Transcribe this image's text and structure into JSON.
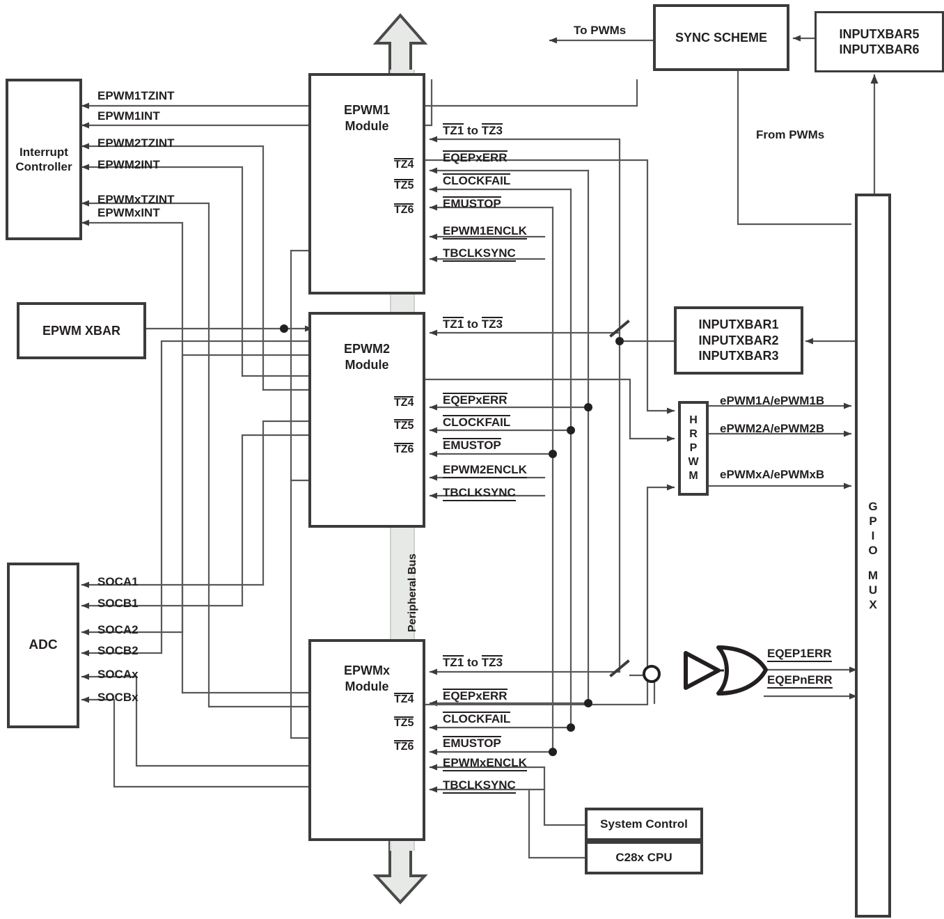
{
  "diagram": {
    "title": "ePWM Module Block Diagram",
    "colors": {
      "ink": "#231f20",
      "box_border": "#3b3b3b",
      "wire": "#58585a",
      "bus_fill": "#e7e9e7",
      "bus_border": "#4a4a4a",
      "page": "#ffffff"
    }
  },
  "blocks": {
    "interrupt_controller": {
      "line1": "Interrupt",
      "line2": "Controller"
    },
    "epwm_xbar": {
      "label": "EPWM XBAR"
    },
    "adc": {
      "label": "ADC"
    },
    "epwm1": {
      "line1": "EPWM1",
      "line2": "Module"
    },
    "epwm2": {
      "line1": "EPWM2",
      "line2": "Module"
    },
    "epwmx": {
      "line1": "EPWMx",
      "line2": "Module"
    },
    "sync_scheme": {
      "label": "SYNC SCHEME"
    },
    "inputxbar56": {
      "line1": "INPUTXBAR5",
      "line2": "INPUTXBAR6"
    },
    "inputxbar123": {
      "line1": "INPUTXBAR1",
      "line2": "INPUTXBAR2",
      "line3": "INPUTXBAR3"
    },
    "hrpwm": {
      "letters": [
        "H",
        "R",
        "P",
        "W",
        "M"
      ]
    },
    "gpio_mux": {
      "letters": [
        "G",
        "P",
        "I",
        "O",
        "",
        "M",
        "U",
        "X"
      ]
    },
    "system_control": {
      "label": "System Control"
    },
    "c28x_cpu": {
      "label": "C28x CPU"
    },
    "peripheral_bus": {
      "label": "Peripheral Bus"
    }
  },
  "interrupt_signals": [
    {
      "name": "EPWM1TZINT"
    },
    {
      "name": "EPWM1INT"
    },
    {
      "name": "EPWM2TZINT"
    },
    {
      "name": "EPWM2INT"
    },
    {
      "name": "EPWMxTZINT"
    },
    {
      "name": "EPWMxINT"
    }
  ],
  "adc_signals": [
    {
      "name": "SOCA1"
    },
    {
      "name": "SOCB1"
    },
    {
      "name": "SOCA2"
    },
    {
      "name": "SOCB2"
    },
    {
      "name": "SOCAx"
    },
    {
      "name": "SOCBx"
    }
  ],
  "tz_port_labels": [
    {
      "name": "TZ4"
    },
    {
      "name": "TZ5"
    },
    {
      "name": "TZ6"
    }
  ],
  "epwm1_inputs": [
    {
      "pre": "TZ1",
      "mid": " to ",
      "post": "TZ3",
      "style": "tz_range"
    },
    {
      "name": "EQEPxERR",
      "style": "overline"
    },
    {
      "name": "CLOCKFAIL",
      "style": "overline"
    },
    {
      "name": "EMUSTOP",
      "style": "overline"
    },
    {
      "name": "EPWM1ENCLK",
      "style": "underline"
    },
    {
      "name": "TBCLKSYNC",
      "style": "underline"
    }
  ],
  "epwm2_inputs": [
    {
      "pre": "TZ1",
      "mid": " to ",
      "post": "TZ3",
      "style": "tz_range"
    },
    {
      "name": "EQEPxERR",
      "style": "overline"
    },
    {
      "name": "CLOCKFAIL",
      "style": "overline"
    },
    {
      "name": "EMUSTOP",
      "style": "overline"
    },
    {
      "name": "EPWM2ENCLK",
      "style": "underline"
    },
    {
      "name": "TBCLKSYNC",
      "style": "underline"
    }
  ],
  "epwmx_inputs": [
    {
      "pre": "TZ1",
      "mid": " to ",
      "post": "TZ3",
      "style": "tz_range"
    },
    {
      "name": "EQEPxERR",
      "style": "overline"
    },
    {
      "name": "CLOCKFAIL",
      "style": "overline"
    },
    {
      "name": "EMUSTOP",
      "style": "overline"
    },
    {
      "name": "EPWMxENCLK",
      "style": "underline"
    },
    {
      "name": "TBCLKSYNC",
      "style": "underline"
    }
  ],
  "pwm_outputs": [
    {
      "name": "ePWM1A/ePWM1B"
    },
    {
      "name": "ePWM2A/ePWM2B"
    },
    {
      "name": "ePWMxA/ePWMxB"
    }
  ],
  "eqep_inputs": [
    {
      "name": "EQEP1ERR",
      "style": "underline"
    },
    {
      "name": "EQEPnERR",
      "style": "underline"
    }
  ],
  "annotations": {
    "to_pwms": "To PWMs",
    "from_pwms": "From PWMs"
  }
}
